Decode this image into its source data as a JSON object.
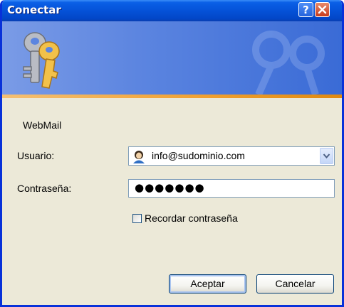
{
  "window": {
    "title": "Conectar",
    "help_icon": "question-mark-icon",
    "close_icon": "close-x-icon"
  },
  "banner": {
    "icon": "keys-icon"
  },
  "form": {
    "server_name": "WebMail",
    "username_label": "Usuario:",
    "username_value": "info@sudominio.com",
    "username_icon": "user-avatar-icon",
    "password_label": "Contraseña:",
    "password_masked": "●●●●●●●",
    "remember_label": "Recordar contraseña",
    "remember_checked": false
  },
  "buttons": {
    "ok": "Aceptar",
    "cancel": "Cancelar"
  },
  "colors": {
    "titlebar": "#0552d8",
    "banner": "#5c85e0",
    "banner_stripe": "#f0a030",
    "window_bg": "#ece9d8"
  }
}
